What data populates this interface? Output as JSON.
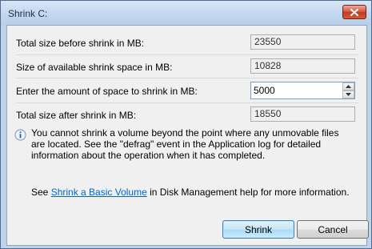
{
  "window": {
    "title": "Shrink C:"
  },
  "fields": {
    "total_before": {
      "label": "Total size before shrink in MB:",
      "value": "23550"
    },
    "available": {
      "label": "Size of available shrink space in MB:",
      "value": "10828"
    },
    "shrink_amount": {
      "label": "Enter the amount of space to shrink in MB:",
      "value": "5000"
    },
    "total_after": {
      "label": "Total size after shrink in MB:",
      "value": "18550"
    }
  },
  "info": {
    "icon": "info-icon",
    "text": "You cannot shrink a volume beyond the point where any unmovable files are located. See the \"defrag\" event in the Application log for detailed information about the operation when it has completed."
  },
  "help": {
    "prefix": "See ",
    "link_text": "Shrink a Basic Volume",
    "suffix": " in Disk Management help for more information."
  },
  "buttons": {
    "shrink": "Shrink",
    "cancel": "Cancel"
  },
  "colors": {
    "link": "#0066cc",
    "close_button": "#c13c23",
    "default_button_border": "#3c7fb1"
  }
}
